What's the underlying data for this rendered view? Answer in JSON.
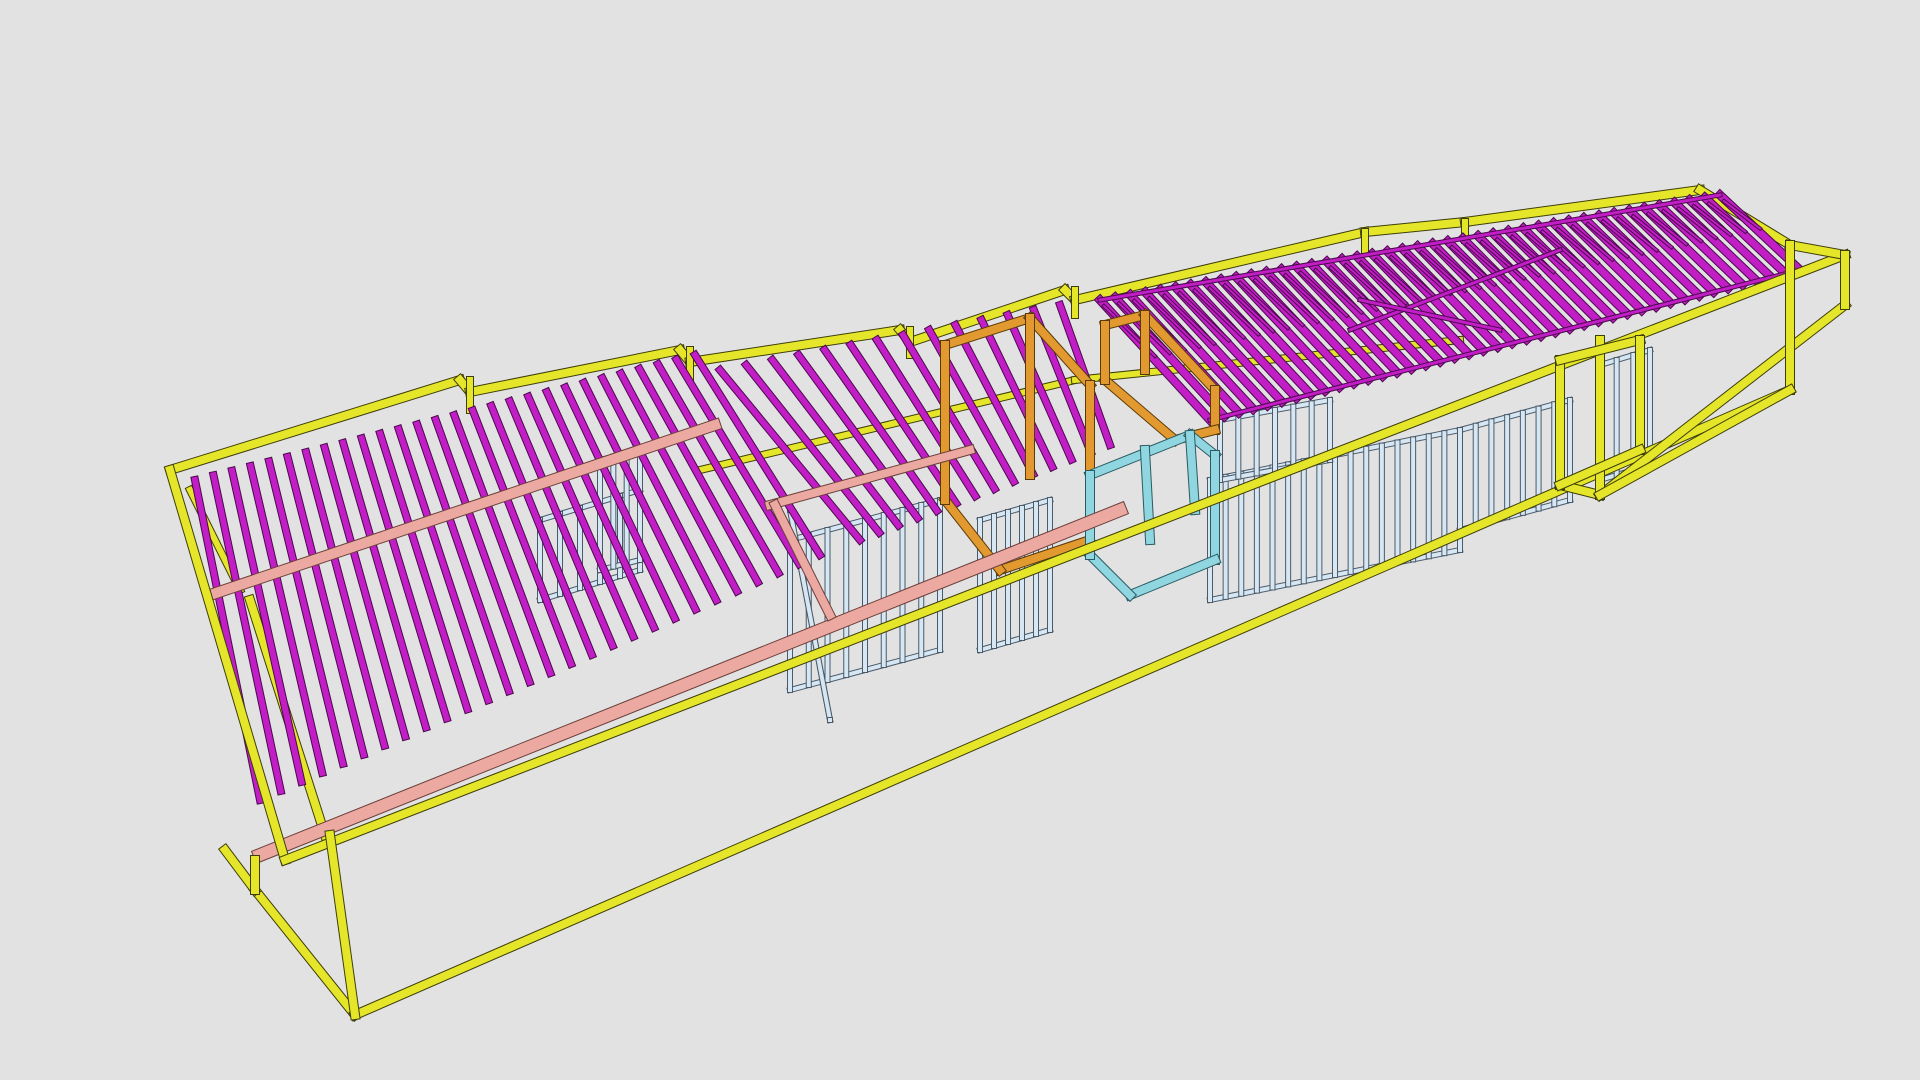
{
  "viewport": {
    "background": "#e2e2e2"
  },
  "model": {
    "view": "isometric",
    "element_colors": {
      "outer_frame": "#e5e52a",
      "outer_frame_edge": "#3e3e0a",
      "roof_joists": "#c21ec6",
      "roof_joists_edge": "#4a0a4c",
      "ridge_beam": "#eca9a2",
      "ridge_beam_edge": "#6b3f3a",
      "orange_frames": "#e29a30",
      "orange_frames_edge": "#5a3a08",
      "cyan_frame": "#8fd6e0",
      "cyan_frame_edge": "#2a5a62",
      "wall_studs": "#d6e6f2",
      "wall_studs_edge": "#4a5a68"
    }
  }
}
